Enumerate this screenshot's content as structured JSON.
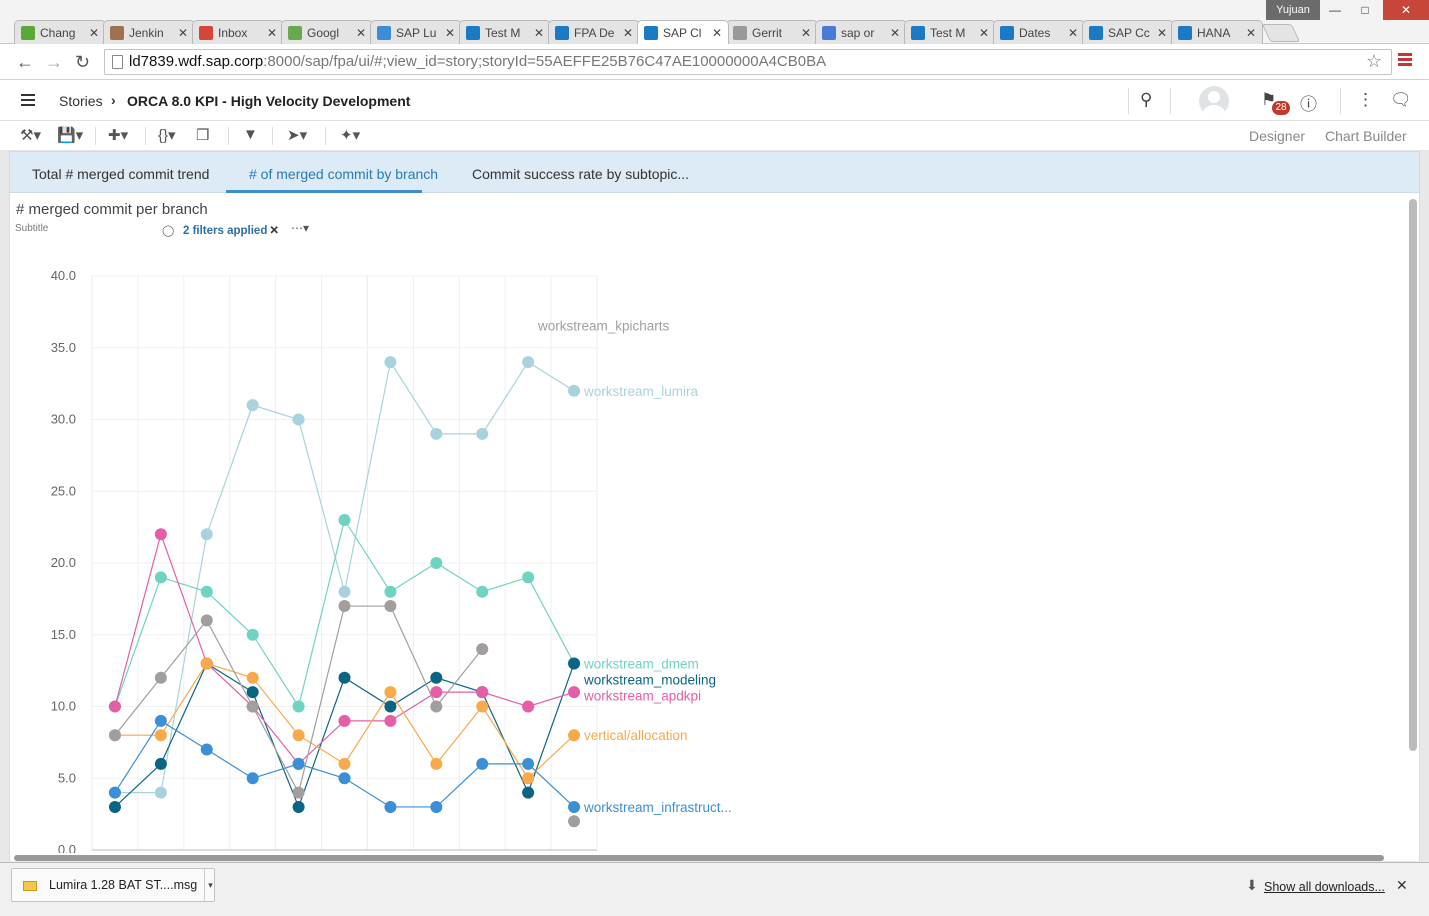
{
  "browser": {
    "tabs": [
      {
        "title": "Chang",
        "favicon": "puzzle-icon",
        "color": "#5aa838"
      },
      {
        "title": "Jenkin",
        "favicon": "jenkins-icon",
        "color": "#a07050"
      },
      {
        "title": "Inbox",
        "favicon": "gmail-icon",
        "color": "#d44638"
      },
      {
        "title": "Googl",
        "favicon": "google-doc-icon",
        "color": "#6aa84f"
      },
      {
        "title": "SAP Lu",
        "favicon": "sap-lumira-icon",
        "color": "#3c8dd5"
      },
      {
        "title": "Test M",
        "favicon": "sap-icon",
        "color": "#1a7ac4"
      },
      {
        "title": "FPA De",
        "favicon": "sap-icon",
        "color": "#1a7ac4"
      },
      {
        "title": "SAP Cl",
        "favicon": "sap-icon",
        "color": "#1a7ac4"
      },
      {
        "title": "Gerrit",
        "favicon": "page-icon",
        "color": "#999999"
      },
      {
        "title": "sap or",
        "favicon": "google-icon",
        "color": "#4a7bd4"
      },
      {
        "title": "Test M",
        "favicon": "sap-icon",
        "color": "#1a7ac4"
      },
      {
        "title": "Dates",
        "favicon": "sap-icon",
        "color": "#1a7ac4"
      },
      {
        "title": "SAP Cc",
        "favicon": "sap-icon",
        "color": "#1a7ac4"
      },
      {
        "title": "HANA",
        "favicon": "sap-icon",
        "color": "#1a7ac4"
      }
    ],
    "active_tab_index": 7,
    "user": "Yujuan",
    "url_host": "ld7839.wdf.sap.corp",
    "url_path": ":8000/sap/fpa/ui/#;view_id=story;storyId=55AEFFE25B76C47AE10000000A4CB0BA"
  },
  "app": {
    "breadcrumb_root": "Stories",
    "breadcrumb_title": "ORCA 8.0 KPI - High Velocity Development",
    "notification_count": "28",
    "toolbar_designer": "Designer",
    "toolbar_chart_builder": "Chart Builder"
  },
  "pages": [
    {
      "label": "Total # merged commit trend"
    },
    {
      "label": "# of merged commit by branch"
    },
    {
      "label": "Commit success rate by subtopic..."
    }
  ],
  "active_page_index": 1,
  "chart_header": {
    "title": "# merged commit per branch",
    "subtitle": "Subtitle",
    "filters": "2 filters applied",
    "more": "⋯"
  },
  "chart_data": {
    "type": "line",
    "ylim": [
      0,
      40
    ],
    "yticks": [
      "40.0",
      "35.0",
      "30.0",
      "25.0",
      "20.0",
      "15.0",
      "10.0",
      "5.0",
      "0.0"
    ],
    "num_points": 11,
    "series": [
      {
        "name": "workstream_lumira",
        "color": "#a9d3dc",
        "values": [
          4,
          4,
          22,
          31,
          30,
          18,
          34,
          29,
          29,
          34,
          32
        ]
      },
      {
        "name": "workstream_dmem",
        "color": "#6fd3c2",
        "values": [
          10,
          19,
          18,
          15,
          10,
          23,
          18,
          20,
          18,
          19,
          13
        ]
      },
      {
        "name": "workstream_modeling",
        "color": "#0a6584",
        "values": [
          3,
          6,
          13,
          11,
          3,
          12,
          10,
          12,
          11,
          4,
          13
        ]
      },
      {
        "name": "workstream_apdkpi",
        "color": "#e45fa6",
        "values": [
          10,
          22,
          13,
          10,
          6,
          9,
          9,
          11,
          11,
          10,
          11
        ]
      },
      {
        "name": "vertical/allocation",
        "color": "#f8a94a",
        "values": [
          8,
          8,
          13,
          12,
          8,
          6,
          11,
          6,
          10,
          5,
          8
        ]
      },
      {
        "name": "workstream_infrastruct...",
        "color": "#3b8fd6",
        "values": [
          4,
          9,
          7,
          5,
          6,
          5,
          3,
          3,
          6,
          6,
          3
        ]
      },
      {
        "name": "workstream_kpicharts",
        "color": "#a39e9e",
        "values": [
          8,
          12,
          16,
          10,
          4,
          17,
          17,
          10,
          14,
          null,
          2
        ]
      }
    ]
  }
}
